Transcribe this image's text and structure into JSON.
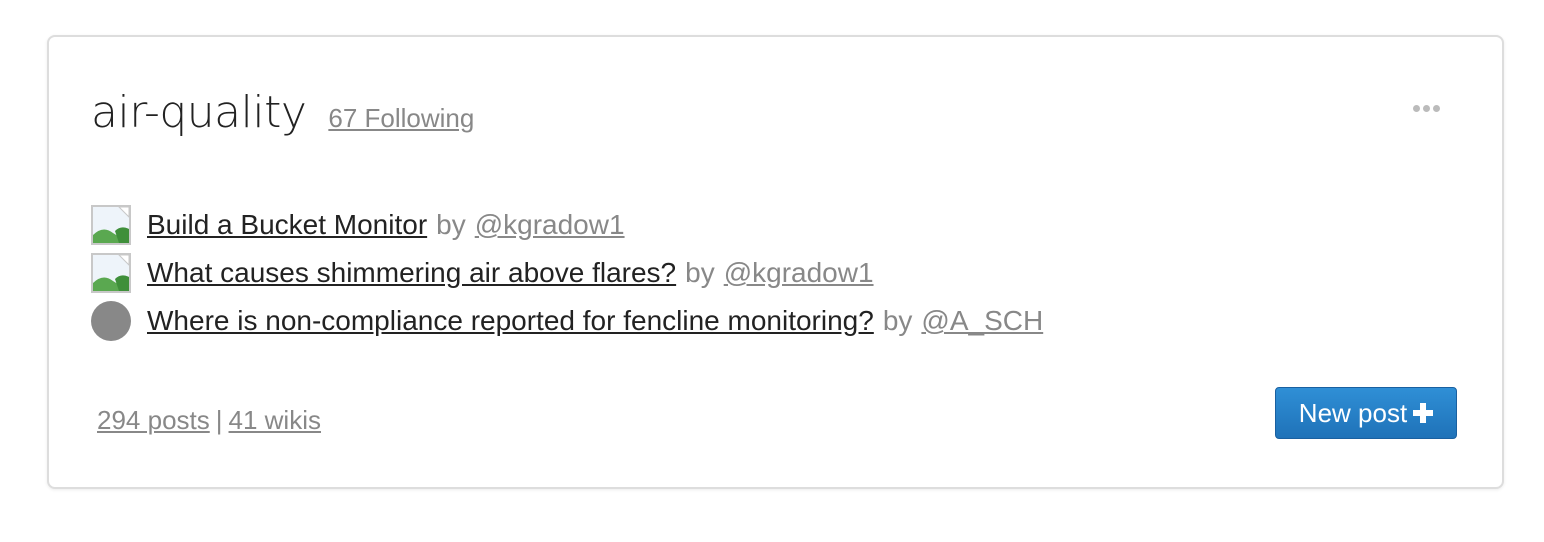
{
  "tag": {
    "title": "air-quality",
    "following_label": "67 Following"
  },
  "menu": {
    "icon": "more-dots-icon"
  },
  "posts": [
    {
      "title": "Build a Bucket Monitor",
      "by_label": "by",
      "author": "@kgradow1",
      "thumb": "broken-image-icon"
    },
    {
      "title": "What causes shimmering air above flares?",
      "by_label": "by",
      "author": "@kgradow1",
      "thumb": "broken-image-icon"
    },
    {
      "title": "Where is non-compliance reported for fencline monitoring?",
      "by_label": "by",
      "author": "@A_SCH",
      "thumb": "default-avatar"
    }
  ],
  "footer": {
    "posts_label": "294 posts",
    "separator": "|",
    "wikis_label": "41 wikis",
    "new_post_label": "New post",
    "new_post_icon": "plus-icon"
  },
  "colors": {
    "button_blue": "#2b85cb",
    "muted_text": "#888888",
    "title_text": "#222222"
  }
}
